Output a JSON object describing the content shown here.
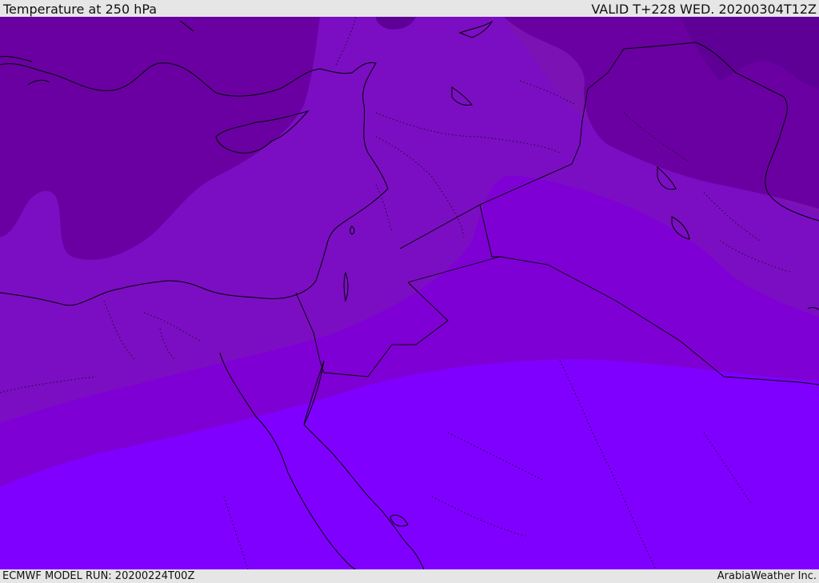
{
  "header": {
    "title": "Temperature at 250 hPa",
    "valid": "VALID T+228 WED. 20200304T12Z"
  },
  "footer": {
    "model_run": "ECMWF MODEL RUN: 20200224T00Z",
    "credit": "ArabiaWeather Inc."
  },
  "map": {
    "field": "Temperature at 250 hPa",
    "shading_colors": [
      "#5e0096",
      "#6a00a2",
      "#7a12b4",
      "#7f00d4",
      "#8000ff"
    ],
    "coastline_color": "#000000",
    "border_style": "dotted"
  }
}
